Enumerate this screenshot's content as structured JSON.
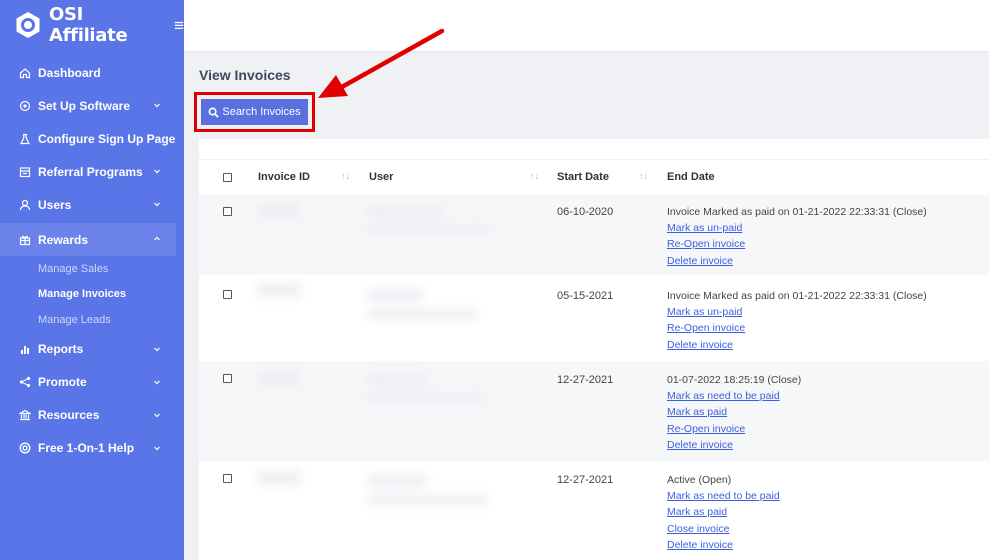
{
  "app": {
    "name": "OSI Affiliate"
  },
  "sidebar": {
    "items": [
      {
        "label": "Dashboard"
      },
      {
        "label": "Set Up Software"
      },
      {
        "label": "Configure Sign Up Page"
      },
      {
        "label": "Referral Programs"
      },
      {
        "label": "Users"
      },
      {
        "label": "Rewards"
      },
      {
        "label": "Reports"
      },
      {
        "label": "Promote"
      },
      {
        "label": "Resources"
      },
      {
        "label": "Free 1-On-1 Help"
      }
    ],
    "rewards_sub": [
      {
        "label": "Manage Sales"
      },
      {
        "label": "Manage Invoices"
      },
      {
        "label": "Manage Leads"
      }
    ]
  },
  "page": {
    "title": "View Invoices"
  },
  "toolbar": {
    "search_label": "Search Invoices"
  },
  "table": {
    "headers": {
      "invoice_id": "Invoice ID",
      "user": "User",
      "start_date": "Start Date",
      "end_date": "End Date"
    },
    "rows": [
      {
        "start_date": "06-10-2020",
        "status": "Invoice Marked as paid on 01-21-2022 22:33:31 (Close)",
        "actions": [
          "Mark as un-paid",
          "Re-Open invoice",
          "Delete invoice"
        ]
      },
      {
        "start_date": "05-15-2021",
        "status": "Invoice Marked as paid on 01-21-2022 22:33:31 (Close)",
        "actions": [
          "Mark as un-paid",
          "Re-Open invoice",
          "Delete invoice"
        ]
      },
      {
        "start_date": "12-27-2021",
        "status": "01-07-2022 18:25:19 (Close)",
        "actions": [
          "Mark as need to be paid",
          "Mark as paid",
          "Re-Open invoice",
          "Delete invoice"
        ]
      },
      {
        "start_date": "12-27-2021",
        "status": "Active (Open)",
        "actions": [
          "Mark as need to be paid",
          "Mark as paid",
          "Close invoice",
          "Delete invoice"
        ]
      }
    ]
  },
  "colors": {
    "sidebar": "#5a75e8",
    "button": "#5a6fe0",
    "highlight": "#e00000",
    "link": "#3b5fe0"
  }
}
